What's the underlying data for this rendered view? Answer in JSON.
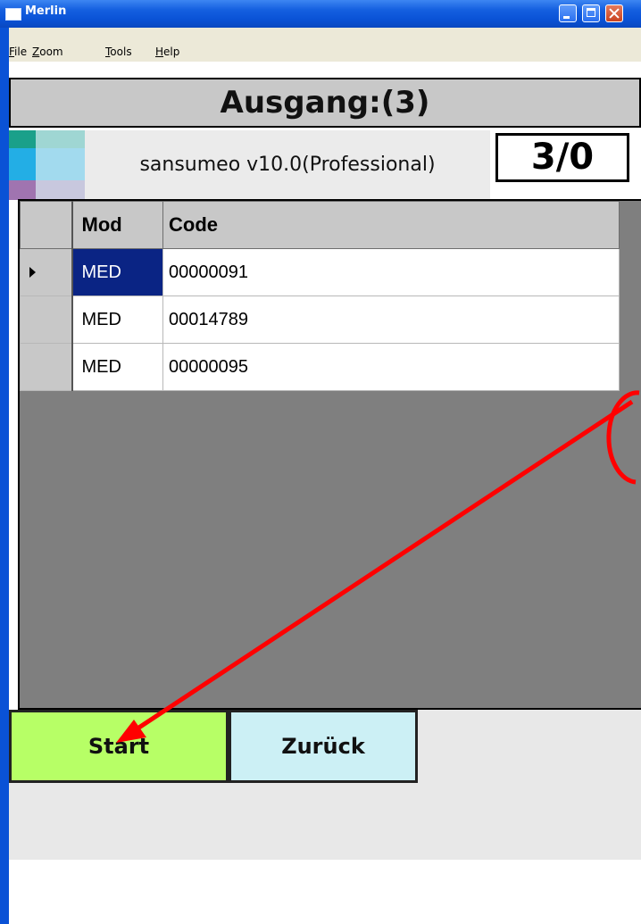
{
  "window": {
    "title": "Merlin",
    "controls": [
      "minimize-icon",
      "maximize-icon",
      "close-icon"
    ]
  },
  "menu": {
    "items": [
      {
        "label_first": "F",
        "label_rest": "ile"
      },
      {
        "label_first": "Z",
        "label_rest": "oom"
      },
      {
        "label_first": "T",
        "label_rest": "ools"
      },
      {
        "label_first": "H",
        "label_rest": "elp"
      }
    ]
  },
  "header": {
    "title": "Ausgang:(3)"
  },
  "app": {
    "label": "sansumeo v10.0(Professional)",
    "counter": "3/0"
  },
  "grid": {
    "columns": [
      "Mod",
      "Code"
    ],
    "rows": [
      {
        "mod": "MED",
        "code": "00000091",
        "selected": true
      },
      {
        "mod": "MED",
        "code": "00014789",
        "selected": false
      },
      {
        "mod": "MED",
        "code": "00000095",
        "selected": false
      }
    ]
  },
  "buttons": {
    "start": "Start",
    "back": "Zurück"
  },
  "colors": {
    "titlebar": "#0a52d6",
    "start_button": "#b7ff66",
    "back_button": "#ccf0f5",
    "selection": "#0a2484",
    "annotation": "#ff0000"
  }
}
